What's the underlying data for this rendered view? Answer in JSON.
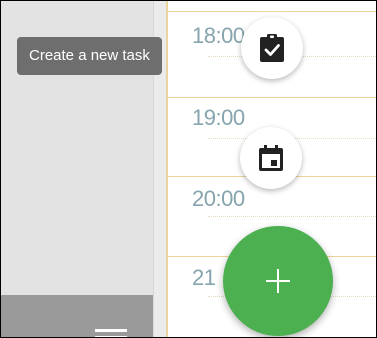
{
  "tooltip": {
    "create_task": "Create a new task"
  },
  "calendar": {
    "hours": [
      "18:00",
      "19:00",
      "20:00",
      "21"
    ]
  },
  "icons": {
    "task_button": "clipboard-check-icon",
    "event_button": "calendar-event-icon",
    "add_button": "plus-icon",
    "menu": "menu-icon"
  },
  "colors": {
    "fab_green": "#4caf50",
    "grid_line": "#ecd49c",
    "time_label": "#86a4ad",
    "tooltip_bg": "#6e6e6e",
    "sidebar_bg": "#e3e3e3",
    "sidebar_footer_bg": "#9a9a9a"
  }
}
